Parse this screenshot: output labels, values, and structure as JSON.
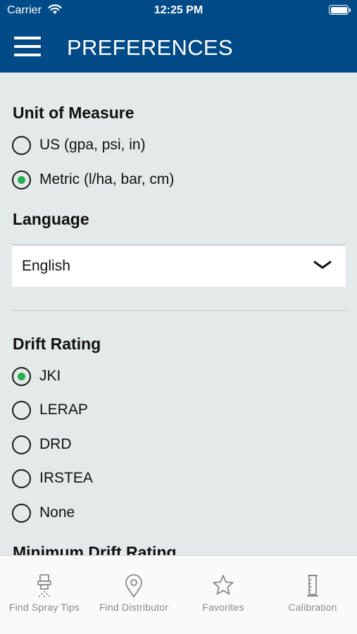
{
  "status_bar": {
    "carrier": "Carrier",
    "time": "12:25 PM",
    "battery_level": 1.0
  },
  "nav": {
    "title": "PREFERENCES"
  },
  "unit_of_measure": {
    "heading": "Unit of Measure",
    "options": [
      {
        "label": "US (gpa, psi, in)",
        "selected": false
      },
      {
        "label": "Metric (l/ha, bar, cm)",
        "selected": true
      }
    ]
  },
  "language": {
    "heading": "Language",
    "selected_value": "English"
  },
  "drift_rating": {
    "heading": "Drift Rating",
    "options": [
      {
        "label": "JKI",
        "selected": true
      },
      {
        "label": "LERAP",
        "selected": false
      },
      {
        "label": "DRD",
        "selected": false
      },
      {
        "label": "IRSTEA",
        "selected": false
      },
      {
        "label": "None",
        "selected": false
      }
    ]
  },
  "minimum_drift_rating": {
    "heading": "Minimum Drift Rating"
  },
  "tabs": [
    {
      "label": "Find Spray Tips",
      "icon": "spray-nozzle-icon"
    },
    {
      "label": "Find Distributor",
      "icon": "map-pin-icon"
    },
    {
      "label": "Favorites",
      "icon": "star-icon"
    },
    {
      "label": "Calibration",
      "icon": "measuring-cylinder-icon"
    }
  ],
  "colors": {
    "nav_background": "#004a87",
    "content_background": "#e3eae9",
    "radio_selected": "#23b04b",
    "tab_inactive": "#8a8a8a"
  }
}
